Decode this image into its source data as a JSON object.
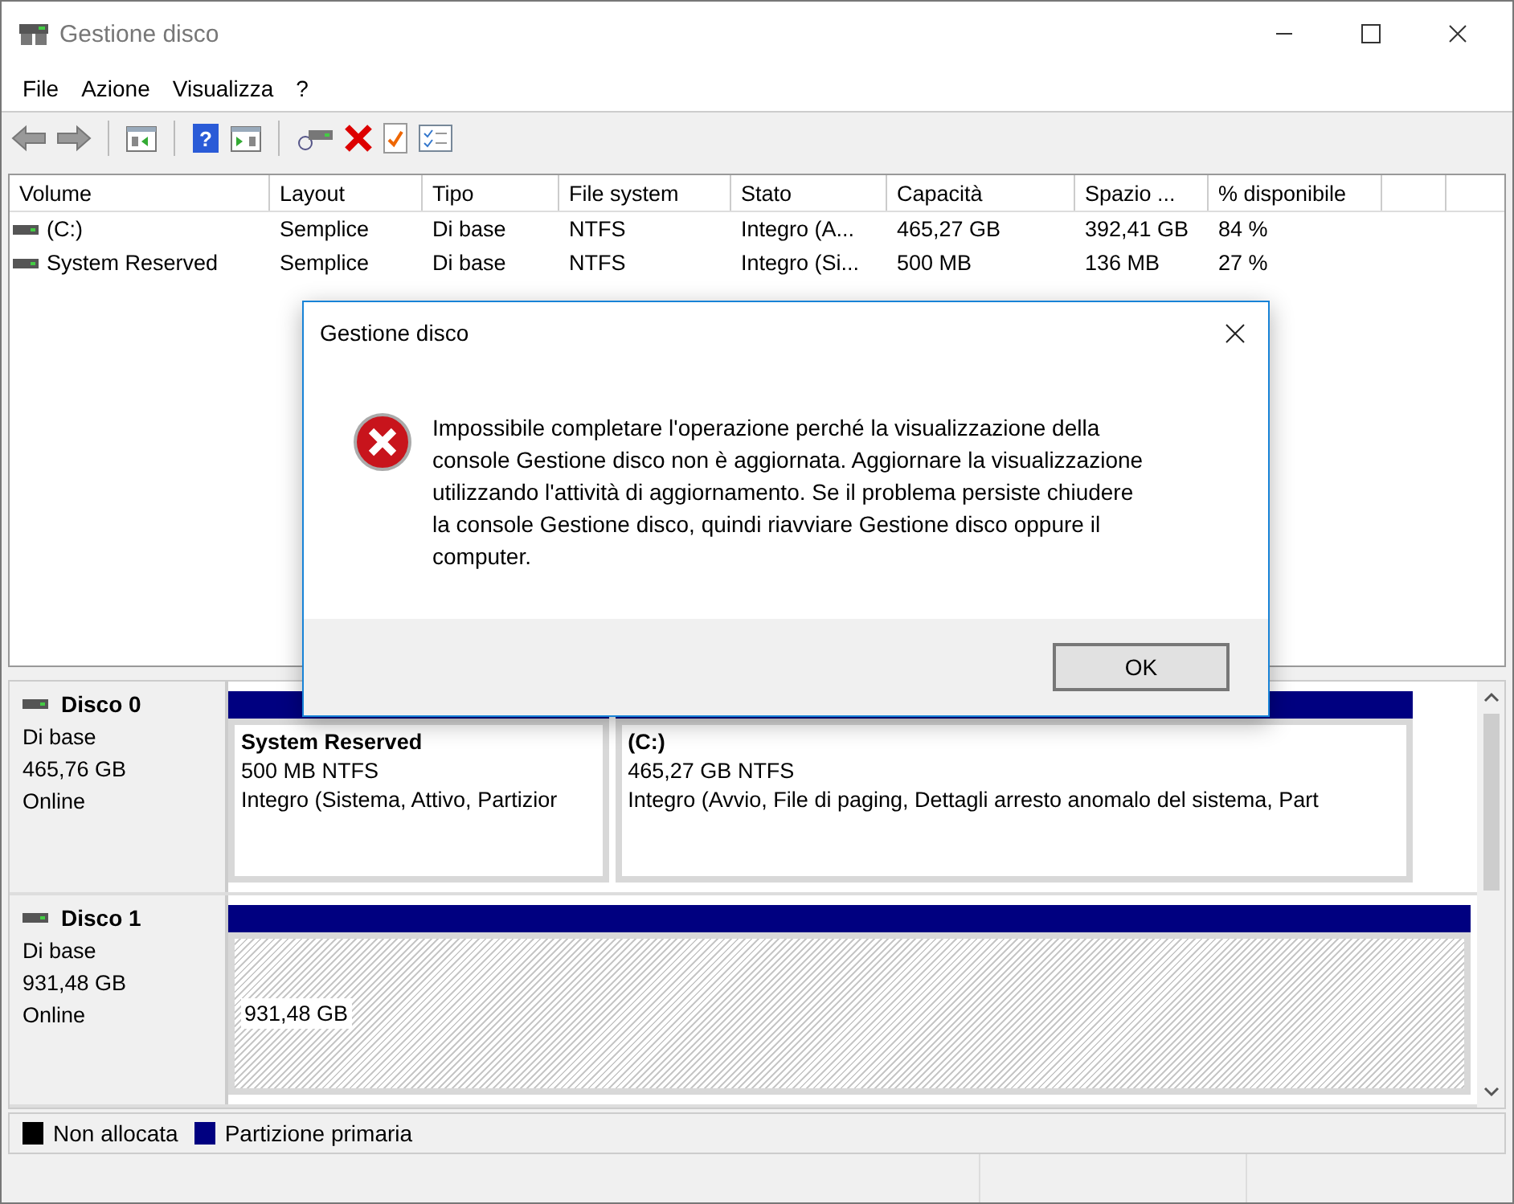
{
  "window": {
    "title": "Gestione disco"
  },
  "menu": [
    "File",
    "Azione",
    "Visualizza",
    "?"
  ],
  "toolbar": {
    "help_glyph": "?"
  },
  "volume_table": {
    "columns": [
      "Volume",
      "Layout",
      "Tipo",
      "File system",
      "Stato",
      "Capacità",
      "Spazio ...",
      "% disponibile"
    ],
    "rows": [
      {
        "cells": [
          "(C:)",
          "Semplice",
          "Di base",
          "NTFS",
          "Integro (A...",
          "465,27 GB",
          "392,41 GB",
          "84 %"
        ]
      },
      {
        "cells": [
          "System Reserved",
          "Semplice",
          "Di base",
          "NTFS",
          "Integro (Si...",
          "500 MB",
          "136 MB",
          "27 %"
        ]
      }
    ]
  },
  "disks": [
    {
      "name": "Disco 0",
      "type": "Di base",
      "size": "465,76 GB",
      "status": "Online",
      "partitions": [
        {
          "kind": "primary",
          "name": "System Reserved",
          "size": "500 MB NTFS",
          "status": "Integro (Sistema, Attivo, Partizior"
        },
        {
          "kind": "primary",
          "name": "(C:)",
          "size": "465,27 GB NTFS",
          "status": "Integro (Avvio, File di paging, Dettagli arresto anomalo del sistema, Part"
        }
      ]
    },
    {
      "name": "Disco 1",
      "type": "Di base",
      "size": "931,48 GB",
      "status": "Online",
      "partitions": [
        {
          "kind": "unallocated",
          "size": "931,48 GB"
        }
      ]
    }
  ],
  "legend": [
    {
      "label": "Non allocata",
      "color": "#000000"
    },
    {
      "label": "Partizione primaria",
      "color": "#000080"
    }
  ],
  "dialog": {
    "title": "Gestione disco",
    "message": "Impossibile completare l'operazione perché la visualizzazione della console Gestione disco non è aggiornata. Aggiornare la visualizzazione utilizzando l'attività di aggiornamento. Se il problema persiste chiudere la console Gestione disco, quindi riavviare Gestione disco oppure il computer.",
    "buttons": [
      "OK"
    ]
  }
}
